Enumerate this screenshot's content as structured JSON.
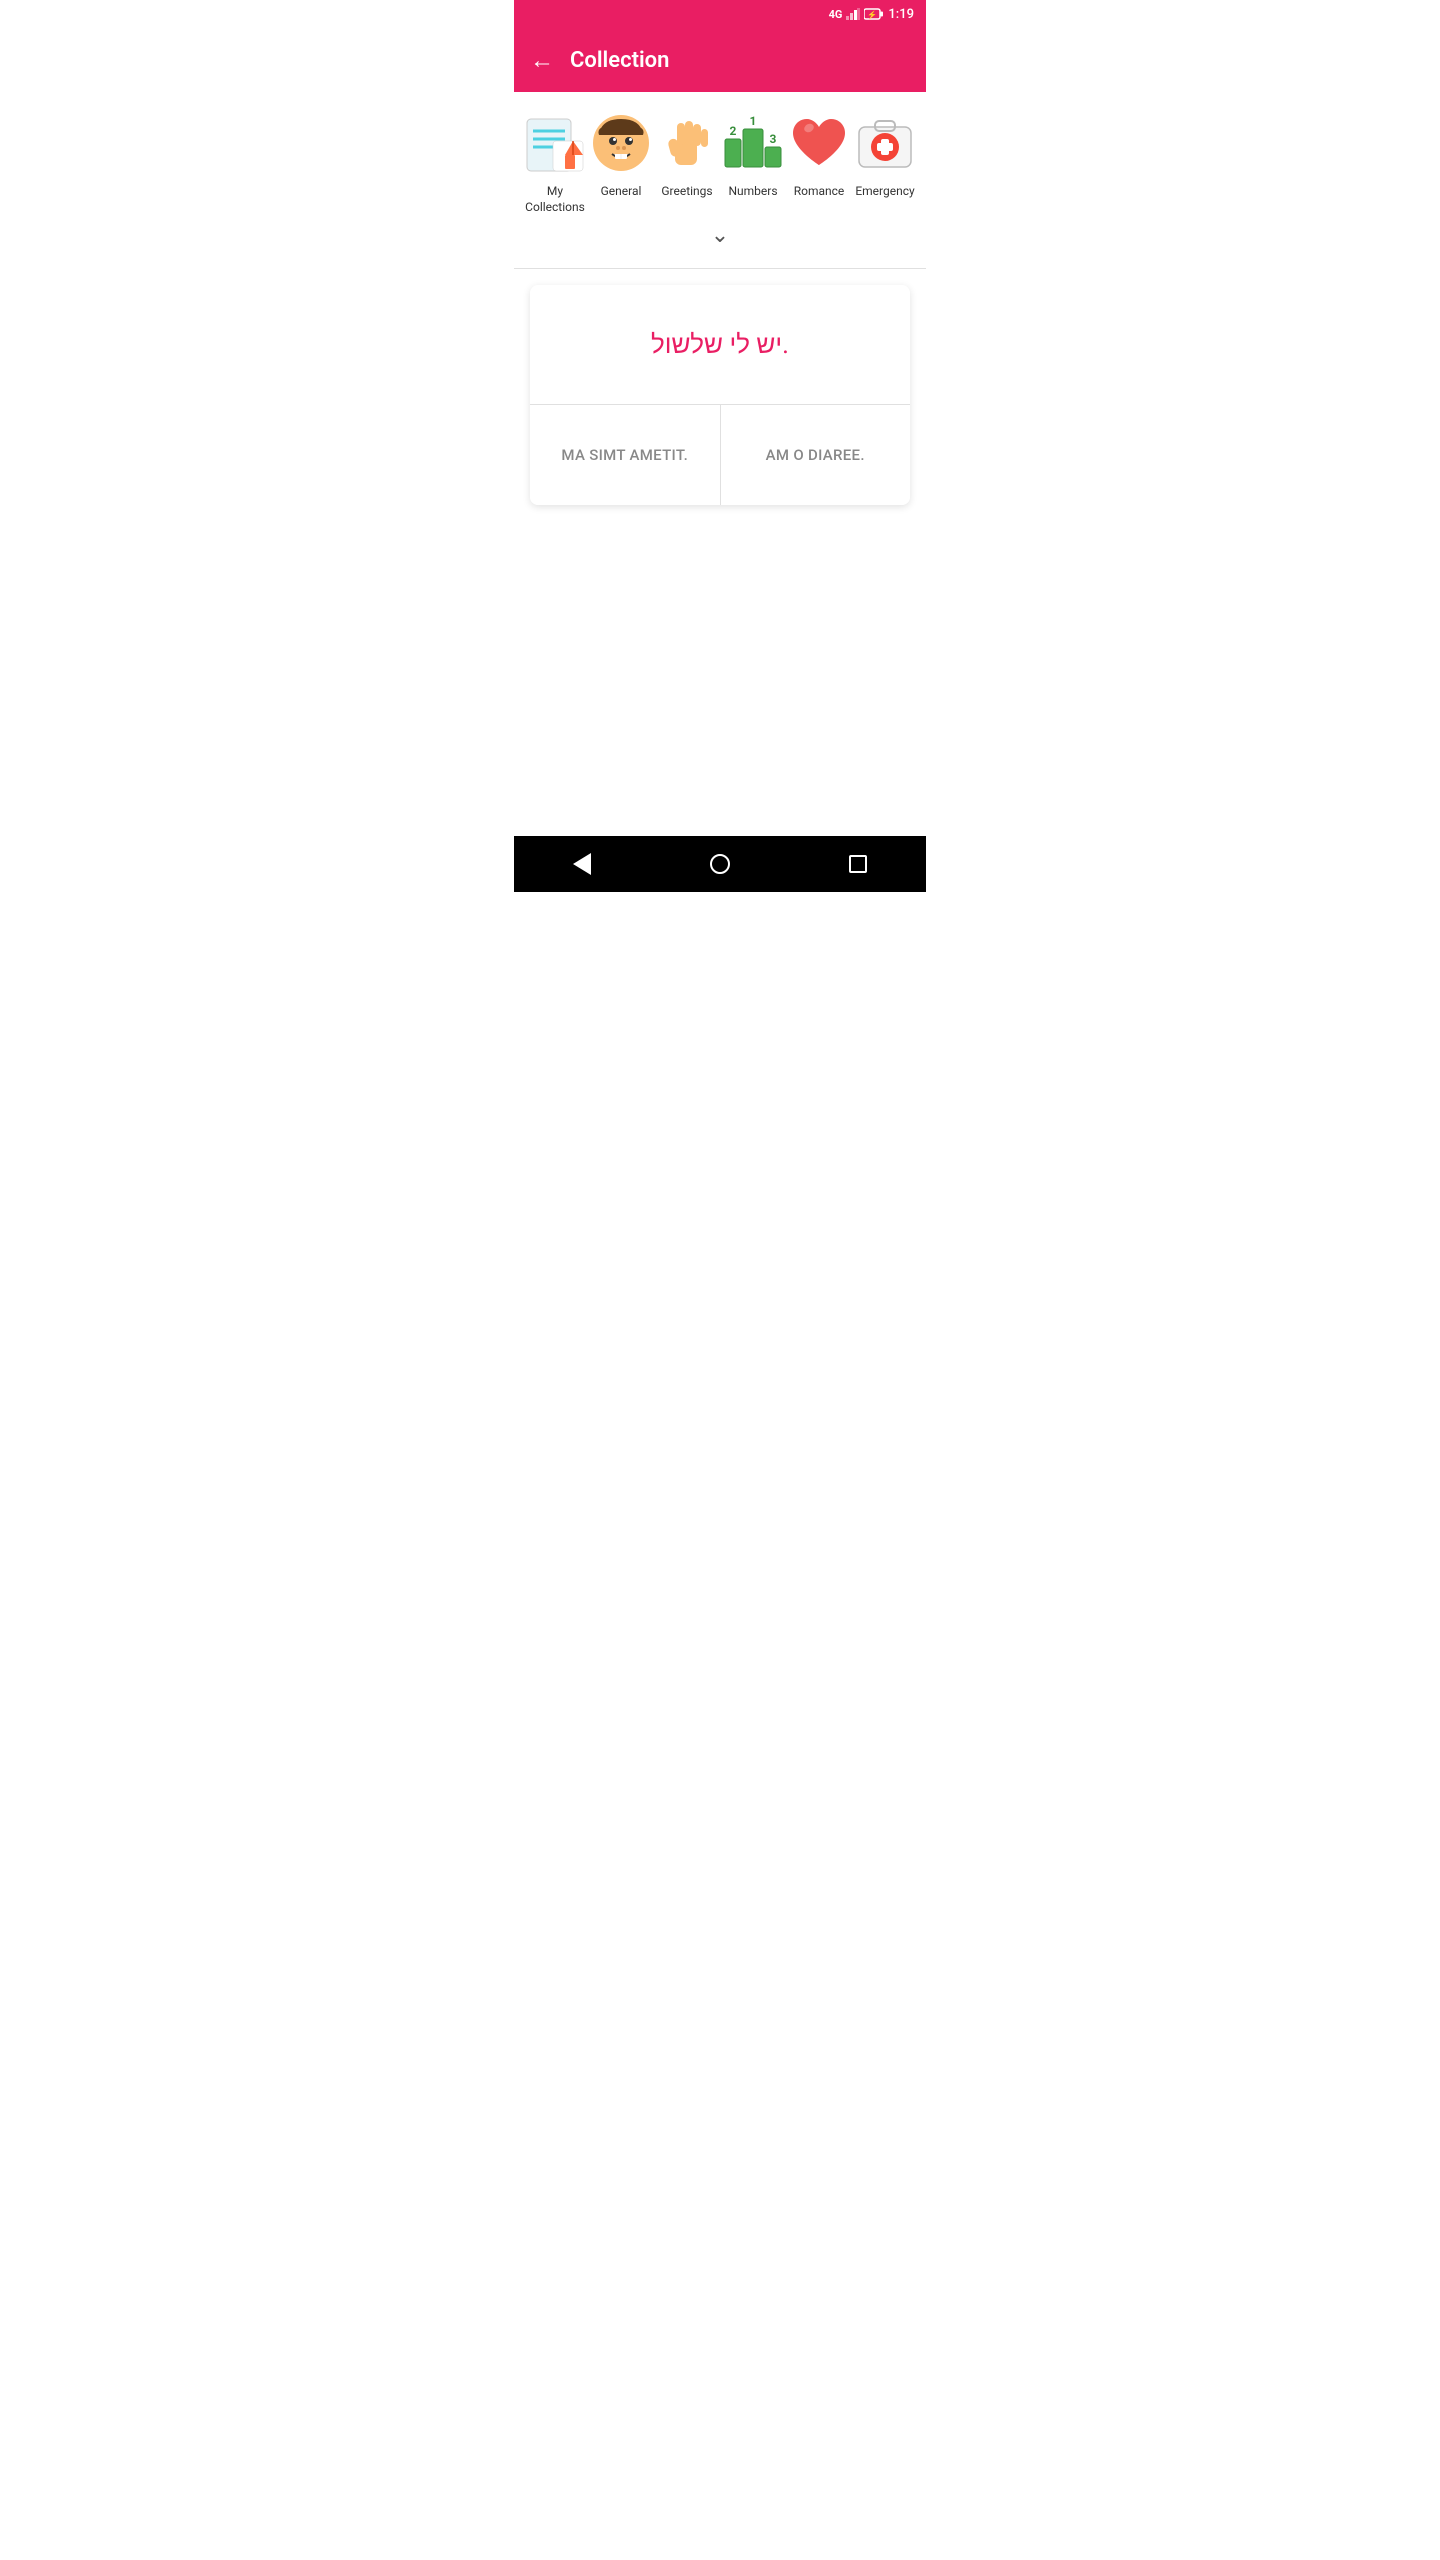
{
  "statusBar": {
    "network": "4G",
    "time": "1:19"
  },
  "appBar": {
    "title": "Collection",
    "backLabel": "←"
  },
  "categories": [
    {
      "id": "my-collections",
      "label": "My Collections",
      "iconType": "my-collections"
    },
    {
      "id": "general",
      "label": "General",
      "iconType": "general"
    },
    {
      "id": "greetings",
      "label": "Greetings",
      "iconType": "greetings"
    },
    {
      "id": "numbers",
      "label": "Numbers",
      "iconType": "numbers"
    },
    {
      "id": "romance",
      "label": "Romance",
      "iconType": "romance"
    },
    {
      "id": "emergency",
      "label": "Emergency",
      "iconType": "emergency"
    }
  ],
  "flashcard": {
    "question": ".יש לי שלשול",
    "answers": [
      {
        "id": "answer-1",
        "text": "MA SIMT AMETIT."
      },
      {
        "id": "answer-2",
        "text": "AM O DIAREE."
      }
    ]
  },
  "bottomNav": {
    "back": "back",
    "home": "home",
    "recent": "recent"
  }
}
